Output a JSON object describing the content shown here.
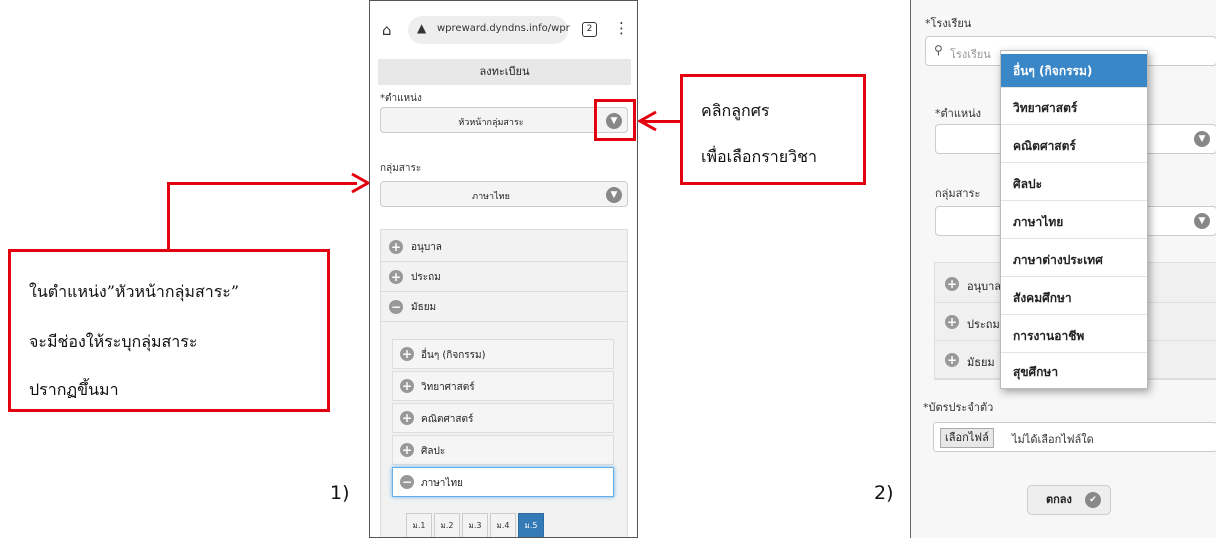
{
  "left_callout": {
    "lines": [
      "ในตำแหน่ง”หัวหน้ากลุ่มสาระ”",
      "จะมีช่องให้ระบุกลุ่มสาระ",
      "ปรากฏขึ้นมา"
    ]
  },
  "right_callout": {
    "lines": [
      "คลิกลูกศร",
      "เพื่อเลือกรายวิชา"
    ]
  },
  "figure_labels": {
    "one": "1)",
    "two": "2)"
  },
  "phone1": {
    "home_icon": "⌂",
    "warn_icon": "▲",
    "url": "wpreward.dyndns.info/wpr",
    "tab_count": "2",
    "menu_icon": "⋮",
    "page_title": "ลงทะเบียน",
    "position_label": "*ตำแหน่ง",
    "position_value": "หัวหน้ากลุ่มสาระ",
    "group_label": "กลุ่มสาระ",
    "group_value": "ภาษาไทย",
    "accordion": [
      {
        "label": "อนุบาล",
        "state": "+"
      },
      {
        "label": "ประถม",
        "state": "+"
      },
      {
        "label": "มัธยม",
        "state": "−"
      }
    ],
    "subjects": [
      {
        "label": "อื่นๆ (กิจกรรม)",
        "state": "+"
      },
      {
        "label": "วิทยาศาสตร์",
        "state": "+"
      },
      {
        "label": "คณิตศาสตร์",
        "state": "+"
      },
      {
        "label": "ศิลปะ",
        "state": "+"
      },
      {
        "label": "ภาษาไทย",
        "state": "−"
      }
    ],
    "grades": [
      "ม.1",
      "ม.2",
      "ม.3",
      "ม.4",
      "ม.5"
    ]
  },
  "phone2": {
    "school_label": "*โรงเรียน",
    "search_icon": "⚲",
    "school_placeholder": "โรงเรียน",
    "position_label": "*ตำแหน่ง",
    "group_label": "กลุ่มสาระ",
    "accordion": [
      {
        "label": "อนุบาล",
        "state": "+"
      },
      {
        "label": "ประถม",
        "state": "+"
      },
      {
        "label": "มัธยม",
        "state": "+"
      }
    ],
    "dropdown": [
      "อื่นๆ (กิจกรรม)",
      "วิทยาศาสตร์",
      "คณิตศาสตร์",
      "ศิลปะ",
      "ภาษาไทย",
      "ภาษาต่างประเทศ",
      "สังคมศึกษา",
      "การงานอาชีพ",
      "สุขศึกษา"
    ],
    "id_card_label": "*บัตรประจำตัว",
    "file_button": "เลือกไฟล์",
    "file_status": "ไม่ได้เลือกไฟล์ใด",
    "ok_button": "ตกลง"
  },
  "colors": {
    "callout_red": "#e3000f",
    "selected_blue": "#3a87c8"
  }
}
